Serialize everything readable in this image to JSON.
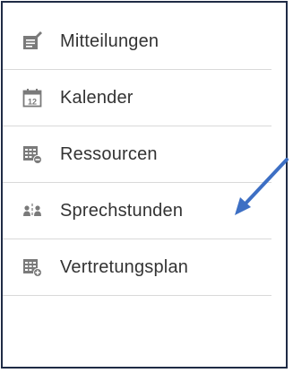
{
  "menu": {
    "items": [
      {
        "label": "Mitteilungen",
        "icon": "messages-edit-icon"
      },
      {
        "label": "Kalender",
        "icon": "calendar-icon"
      },
      {
        "label": "Ressourcen",
        "icon": "resources-grid-icon"
      },
      {
        "label": "Sprechstunden",
        "icon": "consultation-people-icon"
      },
      {
        "label": "Vertretungsplan",
        "icon": "substitution-plan-icon"
      }
    ]
  },
  "calendar_icon_day": "12",
  "colors": {
    "frame_border": "#1f2b45",
    "arrow": "#3d6fc4",
    "text": "#333333",
    "icon": "#7a7a7a",
    "divider": "#d9d9d9"
  }
}
